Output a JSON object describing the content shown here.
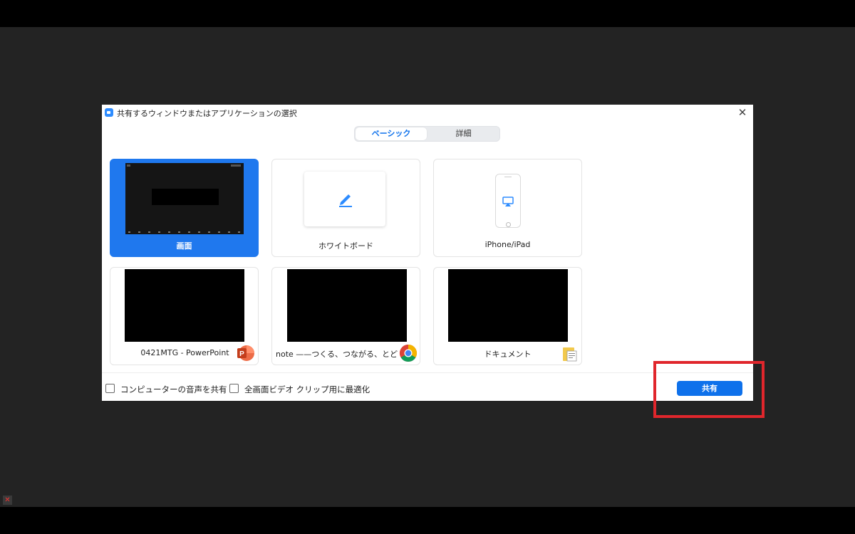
{
  "dialog": {
    "title": "共有するウィンドウまたはアプリケーションの選択",
    "close_glyph": "✕"
  },
  "tabs": [
    {
      "label": "ベーシック",
      "selected": true
    },
    {
      "label": "詳細",
      "selected": false
    }
  ],
  "tiles": [
    {
      "label": "画面",
      "kind": "screen",
      "selected": true
    },
    {
      "label": "ホワイトボード",
      "kind": "whiteboard",
      "icon": "pencil-icon"
    },
    {
      "label": "iPhone/iPad",
      "kind": "device",
      "icon": "airplay-icon"
    },
    {
      "label": "0421MTG - PowerPoint",
      "kind": "window",
      "icon": "powerpoint-icon"
    },
    {
      "label": "note ——つくる、つながる、とどける...",
      "kind": "window",
      "icon": "chrome-icon"
    },
    {
      "label": "ドキュメント",
      "kind": "window",
      "icon": "folder-icon"
    }
  ],
  "options": [
    {
      "label": "コンピューターの音声を共有",
      "checked": false
    },
    {
      "label": "全画面ビデオ クリップ用に最適化",
      "checked": false
    }
  ],
  "share_button": {
    "label": "共有"
  },
  "colors": {
    "accent": "#0e71eb",
    "selected_tile": "#1f78ee",
    "highlight": "#e0262c",
    "backdrop": "#232323"
  }
}
